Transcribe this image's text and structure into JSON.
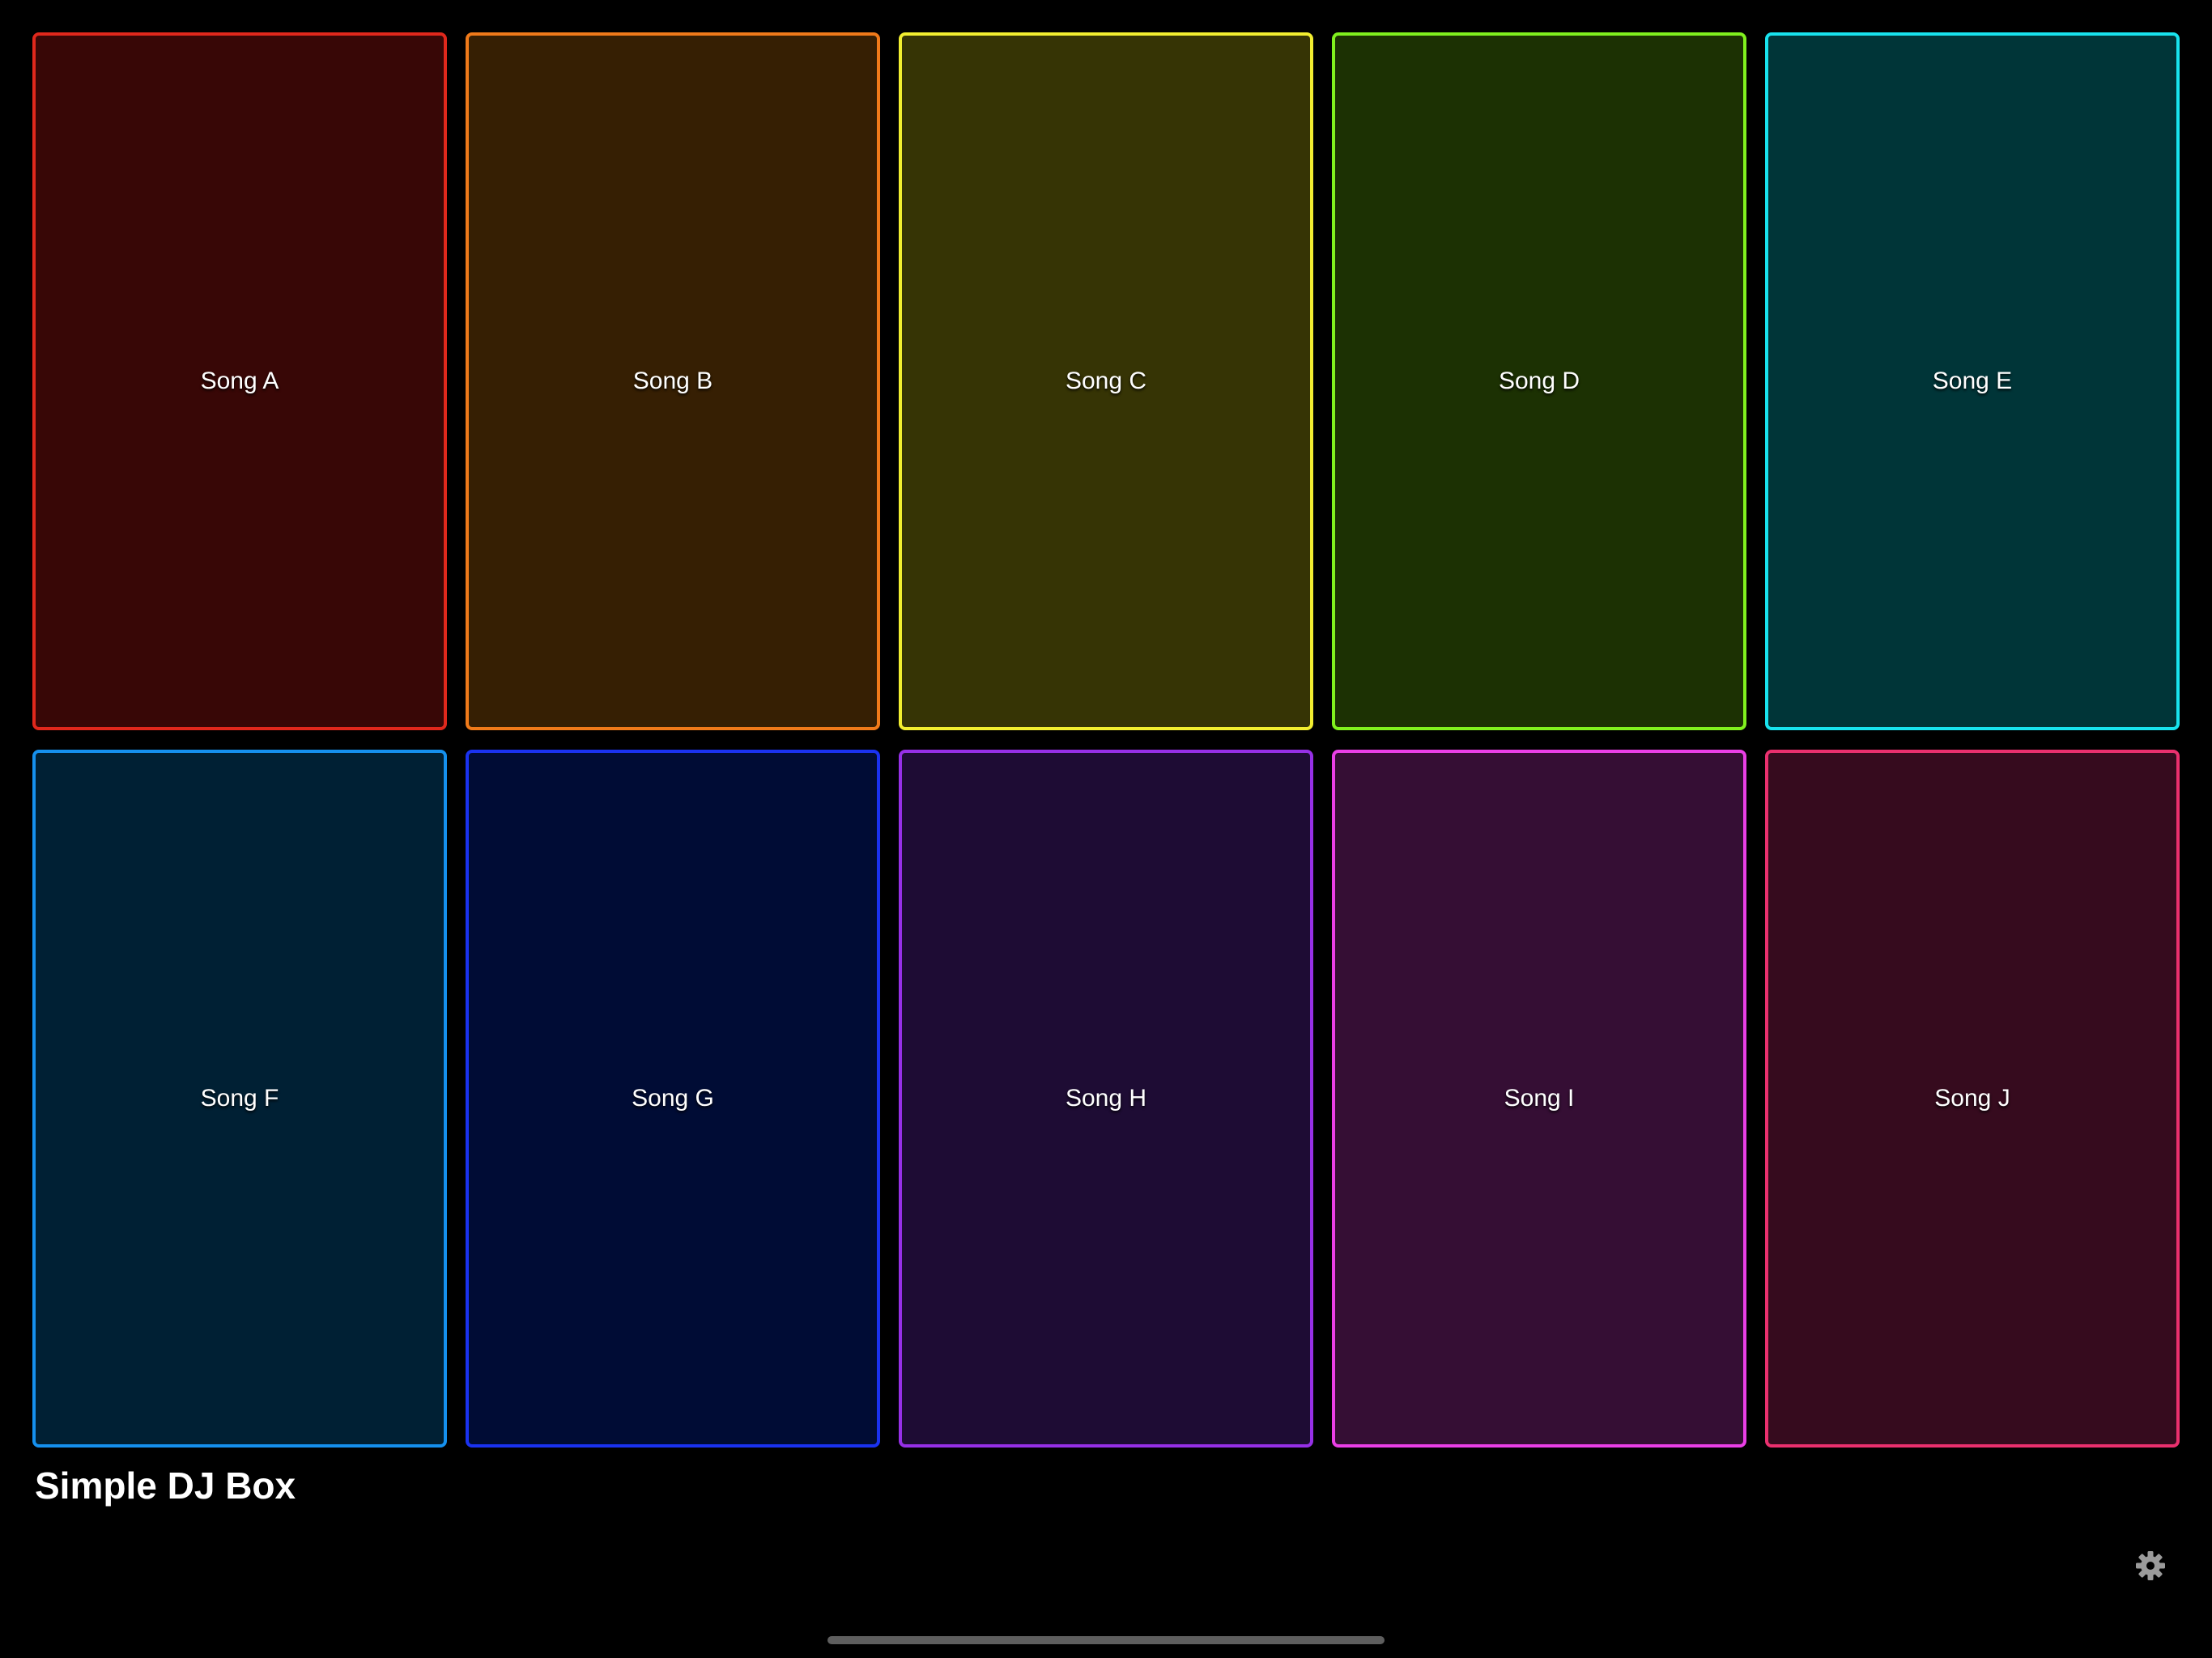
{
  "app": {
    "title": "Simple DJ Box"
  },
  "pads": [
    {
      "label": "Song A",
      "border": "#e0281c",
      "fill": "#380706"
    },
    {
      "label": "Song B",
      "border": "#f07a1a",
      "fill": "#361f03"
    },
    {
      "label": "Song C",
      "border": "#f2ee30",
      "fill": "#363405"
    },
    {
      "label": "Song D",
      "border": "#80f01e",
      "fill": "#1c3103"
    },
    {
      "label": "Song E",
      "border": "#18e3ee",
      "fill": "#003538"
    },
    {
      "label": "Song F",
      "border": "#1590ee",
      "fill": "#002034"
    },
    {
      "label": "Song G",
      "border": "#1a32f0",
      "fill": "#000c35"
    },
    {
      "label": "Song H",
      "border": "#9630e6",
      "fill": "#1e0c34"
    },
    {
      "label": "Song I",
      "border": "#ea3fe6",
      "fill": "#350e34"
    },
    {
      "label": "Song J",
      "border": "#ea306e",
      "fill": "#360b1e"
    }
  ],
  "icons": {
    "settings": "gear-icon"
  },
  "colors": {
    "background": "#000000",
    "gear": "#9a9a9a",
    "home_indicator": "#5e5e5e"
  }
}
